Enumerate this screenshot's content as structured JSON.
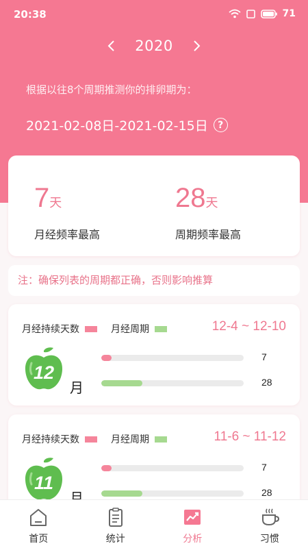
{
  "status_bar": {
    "time": "20:38",
    "battery": "71"
  },
  "header": {
    "year": "2020",
    "predict_text": "根据以往8个周期推测你的排卵期为：",
    "predict_range": "2021-02-08日-2021-02-15日"
  },
  "stats": {
    "period_days": {
      "value": "7",
      "unit": "天",
      "label": "月经频率最高"
    },
    "cycle_days": {
      "value": "28",
      "unit": "天",
      "label": "周期频率最高"
    }
  },
  "note": "注：确保列表的周期都正确，否则影响推算",
  "legend": {
    "period_label": "月经持续天数",
    "cycle_label": "月经周期"
  },
  "colors": {
    "accent": "#f57892",
    "period": "#f5859b",
    "cycle": "#a6d990"
  },
  "cycles": [
    {
      "month": "12",
      "month_char": "月",
      "range": "12-4 ~ 12-10",
      "period_days": "7",
      "cycle_days": "28",
      "period_fraction": 0.07,
      "cycle_fraction": 0.29
    },
    {
      "month": "11",
      "month_char": "月",
      "range": "11-6 ~ 11-12",
      "period_days": "7",
      "cycle_days": "28",
      "period_fraction": 0.07,
      "cycle_fraction": 0.29
    }
  ],
  "tabs": [
    {
      "label": "首页",
      "icon": "home-icon"
    },
    {
      "label": "统计",
      "icon": "clipboard-icon"
    },
    {
      "label": "分析",
      "icon": "chart-icon",
      "active": true
    },
    {
      "label": "习惯",
      "icon": "cup-icon"
    }
  ]
}
